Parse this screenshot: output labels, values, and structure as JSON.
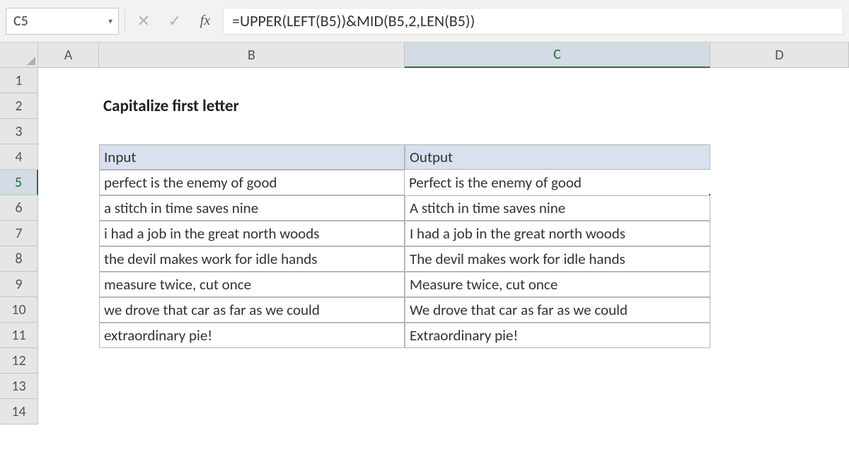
{
  "formula_bar": {
    "name_box": "C5",
    "formula": "=UPPER(LEFT(B5))&MID(B5,2,LEN(B5))",
    "fx_label": "fx",
    "cancel_glyph": "✕",
    "enter_glyph": "✓"
  },
  "columns": [
    "A",
    "B",
    "C",
    "D"
  ],
  "active_column": "C",
  "active_row": "5",
  "rows": [
    "1",
    "2",
    "3",
    "4",
    "5",
    "6",
    "7",
    "8",
    "9",
    "10",
    "11",
    "12",
    "13",
    "14"
  ],
  "title": "Capitalize first letter",
  "table": {
    "header_input": "Input",
    "header_output": "Output",
    "data": [
      {
        "input": "perfect is the enemy of good",
        "output": "Perfect is the enemy of good"
      },
      {
        "input": "a stitch in time saves nine",
        "output": "A stitch in time saves nine"
      },
      {
        "input": "i had a job in the great north woods",
        "output": "I had a job in the great north woods"
      },
      {
        "input": "the devil makes work for idle hands",
        "output": "The devil makes work for idle hands"
      },
      {
        "input": "measure twice, cut once",
        "output": "Measure twice, cut once"
      },
      {
        "input": "we drove that car as far as we could",
        "output": "We drove that car as far as we could"
      },
      {
        "input": "extraordinary pie!",
        "output": "Extraordinary pie!"
      }
    ]
  }
}
